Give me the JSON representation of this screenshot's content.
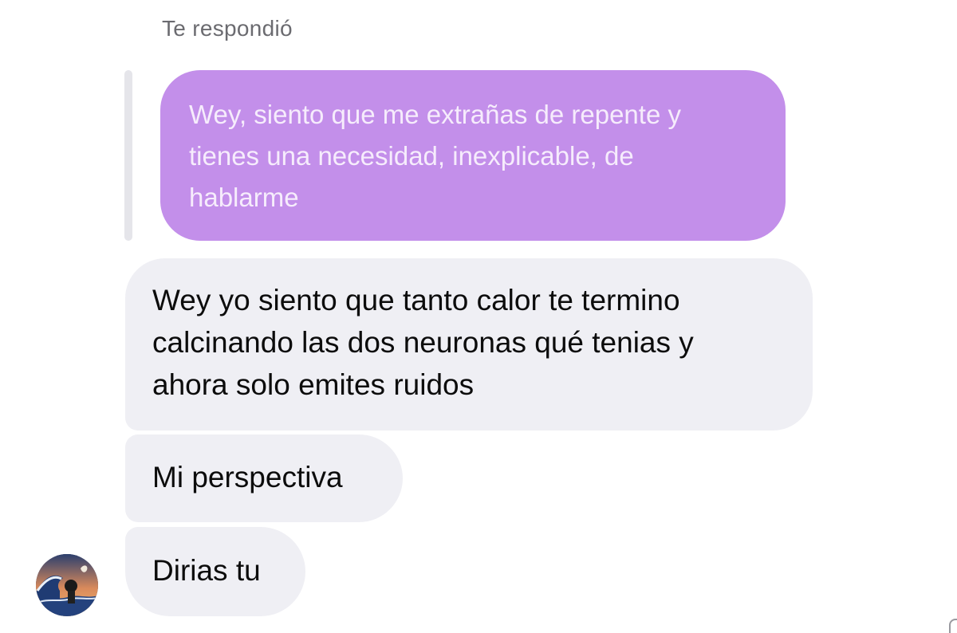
{
  "reply_header": "Te respondió",
  "quoted_message": {
    "text": "Wey, siento que me extrañas de repente y\ntienes una necesidad, inexplicable, de\nhablarme"
  },
  "messages": [
    {
      "text": "Wey yo siento que tanto calor te termino\ncalcinando las dos neuronas qué tenias y\nahora solo emites ruidos"
    },
    {
      "text": "Mi perspectiva"
    },
    {
      "text": "Dirias tu"
    }
  ],
  "colors": {
    "quoted_bubble": "#c38fea",
    "received_bubble": "#efeff4",
    "quote_bar": "#e5e5ea"
  },
  "avatar": {
    "icon": "great-wave-avatar"
  }
}
